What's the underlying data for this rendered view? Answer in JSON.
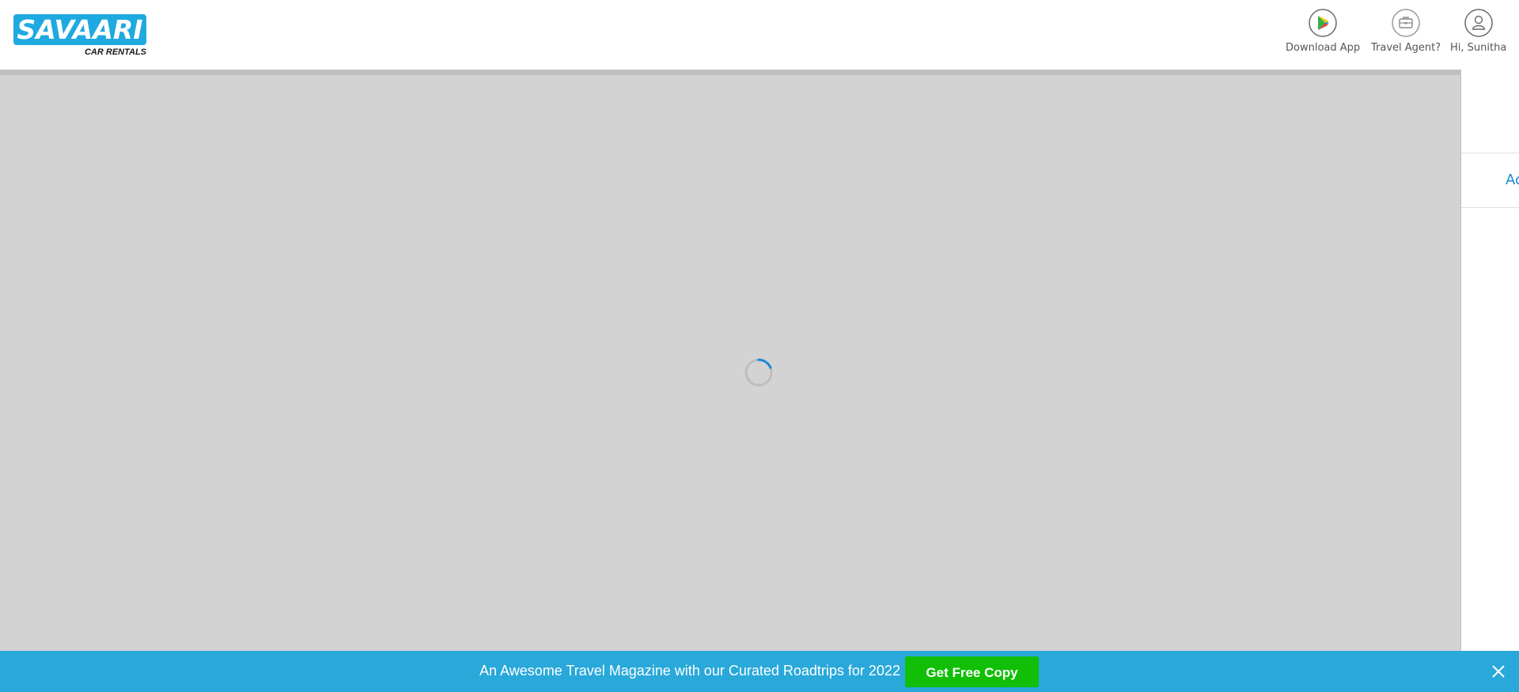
{
  "brand": {
    "name": "SAVAARI",
    "tagline": "CAR RENTALS",
    "color": "#1fa9e1"
  },
  "nav": {
    "items": [
      {
        "label": "Download App",
        "icon": "play-store-icon"
      },
      {
        "label": "Travel Agent?",
        "icon": "briefcase-icon"
      },
      {
        "label": "Hi, Sunitha",
        "icon": "user-icon"
      }
    ]
  },
  "loading": {
    "spinner_icon": "loading-spinner-icon",
    "spinner_color": "#1a88d6"
  },
  "side_panel": {
    "link_text": "Ac"
  },
  "promo": {
    "message": "An Awesome Travel Magazine with our Curated Roadtrips for 2022",
    "button_label": "Get Free Copy",
    "button_color": "#11bf06",
    "bar_color": "#29a8da",
    "close_icon": "close-icon"
  }
}
